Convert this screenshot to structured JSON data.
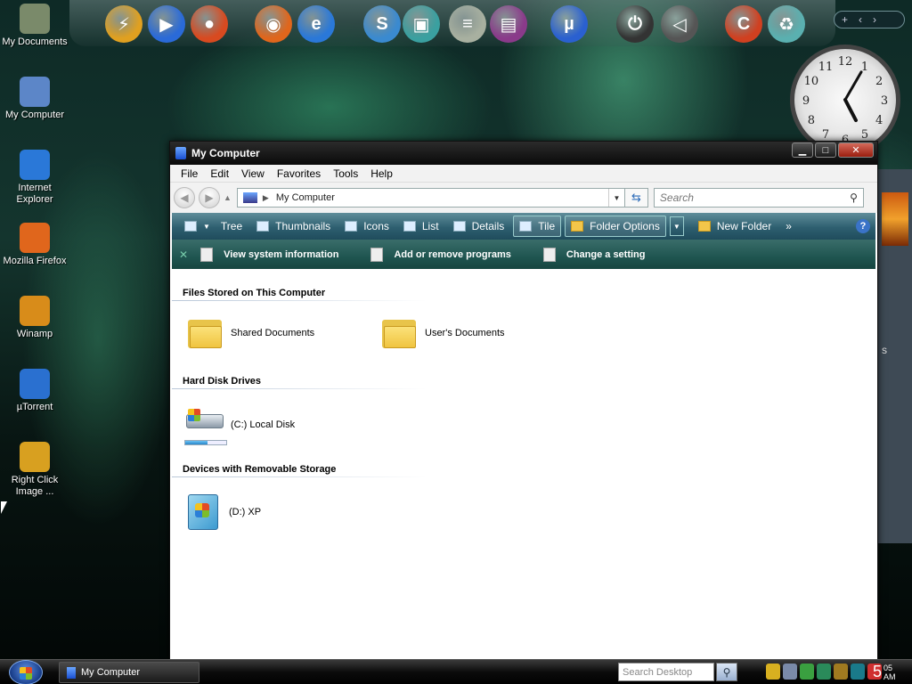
{
  "desktop": {
    "icons": [
      {
        "label": "My Documents",
        "icon": "my-documents-icon",
        "color": "#7a8a6a"
      },
      {
        "label": "My Computer",
        "icon": "my-computer-icon",
        "color": "#5c86c8"
      },
      {
        "label": "Internet Explorer",
        "icon": "internet-explorer-icon",
        "color": "#2a78d8"
      },
      {
        "label": "Mozilla Firefox",
        "icon": "firefox-icon",
        "color": "#e0661c"
      },
      {
        "label": "Winamp",
        "icon": "winamp-icon",
        "color": "#d88c1a"
      },
      {
        "label": "µTorrent",
        "icon": "utorrent-icon",
        "color": "#2a70d0"
      },
      {
        "label": "Right Click Image ...",
        "icon": "right-click-image-icon",
        "color": "#d8a020"
      }
    ]
  },
  "dock": {
    "items": [
      {
        "icon": "winamp-icon",
        "color": "#e0a020",
        "glyph": "⚡"
      },
      {
        "icon": "media-player-icon",
        "color": "#2a6ad8",
        "glyph": "▶"
      },
      {
        "icon": "record-icon",
        "color": "#d84a20",
        "glyph": "●"
      },
      {
        "icon": "firefox-icon",
        "color": "#e0661c",
        "glyph": "◉"
      },
      {
        "icon": "internet-explorer-icon",
        "color": "#2a78d8",
        "glyph": "e"
      },
      {
        "icon": "skype-icon",
        "color": "#3a8ad0",
        "glyph": "S"
      },
      {
        "icon": "monitor-icon",
        "color": "#3aa0a0",
        "glyph": "▣"
      },
      {
        "icon": "notepad-icon",
        "color": "#a8b0a0",
        "glyph": "≡"
      },
      {
        "icon": "winrar-icon",
        "color": "#8a3a8a",
        "glyph": "▤"
      },
      {
        "icon": "utorrent-icon",
        "color": "#2a60d0",
        "glyph": "µ"
      },
      {
        "icon": "power-icon",
        "color": "#333333",
        "glyph": "⏻"
      },
      {
        "icon": "logoff-icon",
        "color": "#555555",
        "glyph": "◁"
      },
      {
        "icon": "ccleaner-icon",
        "color": "#d04020",
        "glyph": "C"
      },
      {
        "icon": "recycle-bin-icon",
        "color": "#5ab0b0",
        "glyph": "♻"
      }
    ],
    "controls": {
      "add": "+",
      "prev": "‹",
      "next": "›"
    }
  },
  "clock": {
    "numbers": [
      "12",
      "1",
      "2",
      "3",
      "4",
      "5",
      "6",
      "7",
      "8",
      "9",
      "10",
      "11"
    ],
    "hour": 5,
    "minute": 5
  },
  "window": {
    "title": "My Computer",
    "menu": [
      "File",
      "Edit",
      "View",
      "Favorites",
      "Tools",
      "Help"
    ],
    "address": "My Computer",
    "search_placeholder": "Search",
    "toolbar": {
      "tree": "Tree",
      "thumbnails": "Thumbnails",
      "icons": "Icons",
      "list": "List",
      "details": "Details",
      "tile": "Tile",
      "folder_options": "Folder Options",
      "new_folder": "New Folder",
      "more": "»",
      "help": "?"
    },
    "tasks": [
      "View system information",
      "Add or remove programs",
      "Change a setting"
    ],
    "sections": {
      "files": {
        "heading": "Files Stored on This Computer",
        "items": [
          "Shared Documents",
          "User's Documents"
        ]
      },
      "drives": {
        "heading": "Hard Disk Drives",
        "items": [
          {
            "label": "(C:) Local Disk",
            "used": 0.55
          }
        ]
      },
      "removable": {
        "heading": "Devices with Removable Storage",
        "items": [
          "(D:) XP"
        ]
      }
    }
  },
  "background_window": {
    "letter": "s"
  },
  "taskbar": {
    "window_button": "My Computer",
    "search_placeholder": "Search Desktop",
    "clock_hour": "5",
    "clock_minute": "05",
    "clock_ampm": "AM",
    "tray_icons": [
      {
        "icon": "shield-icon",
        "color": "#d8b020"
      },
      {
        "icon": "search-icon",
        "color": "#7a8aa8"
      },
      {
        "icon": "network-icon",
        "color": "#3aa040"
      },
      {
        "icon": "display-icon",
        "color": "#2a8a5a"
      },
      {
        "icon": "winamp-tray-icon",
        "color": "#a07a20"
      },
      {
        "icon": "media-icon",
        "color": "#1a7a8a"
      },
      {
        "icon": "security-alert-icon",
        "color": "#d03030"
      }
    ]
  }
}
